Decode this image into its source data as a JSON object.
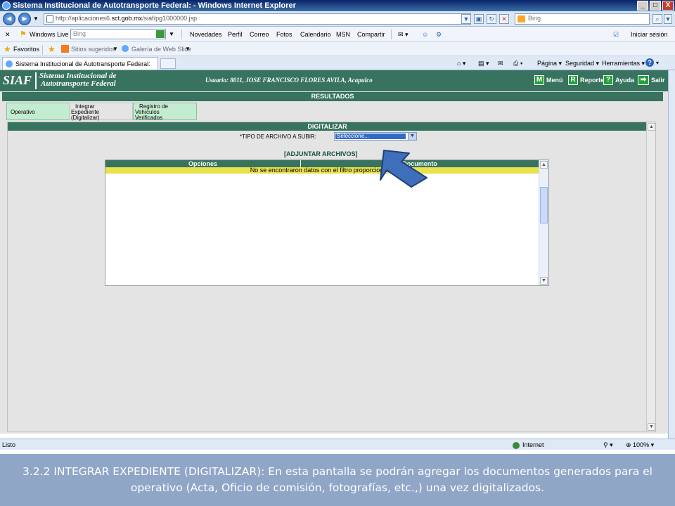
{
  "window": {
    "title": "Sistema Institucional de Autotransporte Federal: - Windows Internet Explorer",
    "min_label": "_",
    "max_label": "□",
    "close_label": "X"
  },
  "address": {
    "url_prefix": "http://aplicaciones6.",
    "url_host": "sct.gob.mx",
    "url_path": "/siaf/pg1000000.jsp",
    "search_placeholder": "Bing"
  },
  "live_toolbar": {
    "close_label": "✕",
    "brand": "Windows Live",
    "search_placeholder": "Bing",
    "links": [
      "Novedades",
      "Perfil",
      "Correo",
      "Fotos",
      "Calendario",
      "MSN",
      "Compartir"
    ],
    "signin": "Iniciar sesión"
  },
  "favorites_bar": {
    "favorites": "Favoritos",
    "suggested": "Sitios sugeridos",
    "webslice": "Galería de Web Slice"
  },
  "tab": {
    "title": "Sistema Institucional de Autotransporte Federal:"
  },
  "command_bar": {
    "page": "Página",
    "security": "Seguridad",
    "tools": "Herramientas"
  },
  "siaf_header": {
    "logo": "SIAF",
    "name_line1": "Sistema Institucional de",
    "name_line2": "Autotransporte Federal",
    "user": "Usuario: 8011, JOSE FRANCISCO FLORES AVILA, Acapulco",
    "menu": {
      "icon": "M",
      "label": "Menú"
    },
    "report": {
      "icon": "R",
      "label": "Reporte"
    },
    "help": {
      "icon": "?",
      "label": "Ayuda"
    },
    "exit": {
      "icon": "➡",
      "label": "Salir"
    }
  },
  "results": {
    "title": "RESULTADOS",
    "buttons": {
      "operativo": "Operativo",
      "integrar_line1": "Integrar",
      "integrar_line2": "Expediente",
      "integrar_line3": "(Digitalizar)",
      "registro_line1": "Registro de",
      "registro_line2": "Vehículos",
      "registro_line3": "Verificados"
    }
  },
  "digitalizar": {
    "title": "DIGITALIZAR",
    "tipo_label": "*TIPO DE ARCHIVO A SUBIR:",
    "tipo_selected": "Seleccione...",
    "adjuntar": "[ADJUNTAR ARCHIVOS]",
    "col_opciones": "Opciones",
    "col_documento": "Documento",
    "no_data": "No se encontraron datos con el filtro proporcionado"
  },
  "status_bar": {
    "status": "Listo",
    "zone": "Internet",
    "zoom": "100%"
  },
  "caption": "3.2.2 INTEGRAR EXPEDIENTE (DIGITALIZAR): En esta pantalla se podrán agregar los documentos generados para el operativo (Acta, Oficio de comisión, fotografías, etc.,) una vez digitalizados.",
  "colors": {
    "siaf_green": "#37735e",
    "button_green": "#c4ecd0",
    "no_data_yellow": "#e8e24c",
    "arrow_blue": "#3f6fba",
    "caption_bg": "#8fa6c7"
  }
}
